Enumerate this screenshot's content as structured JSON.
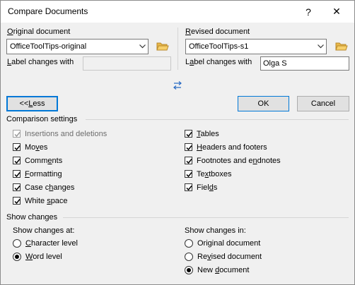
{
  "window": {
    "title": "Compare Documents",
    "help": "?",
    "close": "✕"
  },
  "original": {
    "heading_pre": "",
    "heading_u": "O",
    "heading_post": "riginal document",
    "selected": "OfficeToolTips-original",
    "label_changes_pre": "",
    "label_changes_u": "L",
    "label_changes_post": "abel changes with",
    "label_value": ""
  },
  "revised": {
    "heading_pre": "",
    "heading_u": "R",
    "heading_post": "evised document",
    "selected": "OfficeToolTips-s1",
    "label_changes_pre": "L",
    "label_changes_u": "a",
    "label_changes_post": "bel changes with",
    "label_value": "Olga S"
  },
  "swap_icon": "swap-arrows-icon",
  "buttons": {
    "less_pre": "<< ",
    "less_u": "L",
    "less_post": "ess",
    "ok": "OK",
    "cancel": "Cancel"
  },
  "comparison_settings": {
    "heading": "Comparison settings",
    "left": [
      {
        "pre": "",
        "u": "",
        "post": "Insertions and deletions",
        "checked": true,
        "disabled": true
      },
      {
        "pre": "Mo",
        "u": "v",
        "post": "es",
        "checked": true,
        "disabled": false
      },
      {
        "pre": "Comm",
        "u": "e",
        "post": "nts",
        "checked": true,
        "disabled": false
      },
      {
        "pre": "",
        "u": "F",
        "post": "ormatting",
        "checked": true,
        "disabled": false
      },
      {
        "pre": "Case c",
        "u": "h",
        "post": "anges",
        "checked": true,
        "disabled": false
      },
      {
        "pre": "White ",
        "u": "s",
        "post": "pace",
        "checked": true,
        "disabled": false
      }
    ],
    "right": [
      {
        "pre": "",
        "u": "T",
        "post": "ables",
        "checked": true
      },
      {
        "pre": "",
        "u": "H",
        "post": "eaders and footers",
        "checked": true
      },
      {
        "pre": "Footnotes and e",
        "u": "n",
        "post": "dnotes",
        "checked": true
      },
      {
        "pre": "Te",
        "u": "x",
        "post": "tboxes",
        "checked": true
      },
      {
        "pre": "Fiel",
        "u": "d",
        "post": "s",
        "checked": true
      }
    ]
  },
  "show_changes": {
    "heading": "Show changes",
    "at_label": "Show changes at:",
    "at_options": [
      {
        "pre": "",
        "u": "C",
        "post": "haracter level",
        "selected": false
      },
      {
        "pre": "",
        "u": "W",
        "post": "ord level",
        "selected": true
      }
    ],
    "in_label": "Show changes in:",
    "in_options": [
      {
        "pre": "Ori",
        "u": "g",
        "post": "inal document",
        "selected": false
      },
      {
        "pre": "Re",
        "u": "v",
        "post": "ised document",
        "selected": false
      },
      {
        "pre": "New ",
        "u": "d",
        "post": "ocument",
        "selected": true
      }
    ]
  }
}
